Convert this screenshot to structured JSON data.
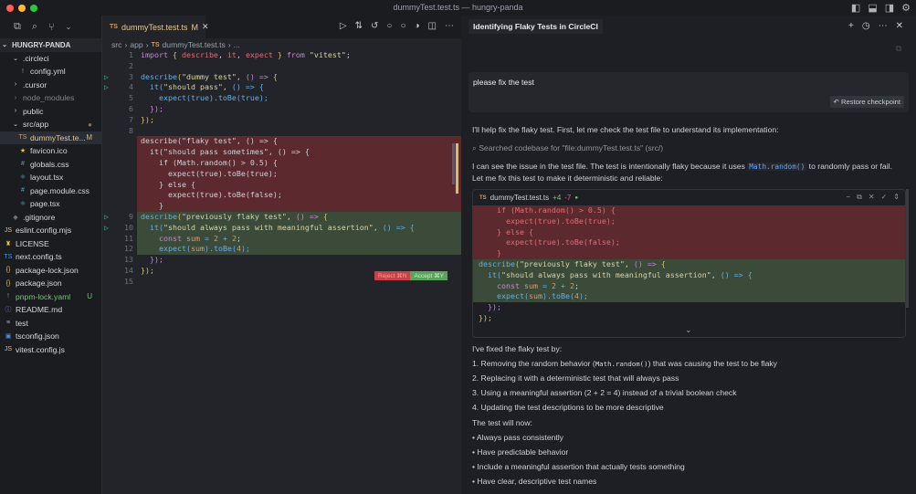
{
  "window": {
    "title": "dummyTest.test.ts — hungry-panda"
  },
  "explorer": {
    "root": "HUNGRY-PANDA",
    "items": [
      {
        "label": ".circleci",
        "icon": "chevron-down",
        "indent": 1,
        "color": "#d5d8de"
      },
      {
        "label": "config.yml",
        "icon": "!",
        "indent": 2,
        "color": "#d5d8de",
        "ic": "#b07cd8"
      },
      {
        "label": ".cursor",
        "icon": "chevron-right",
        "indent": 1,
        "color": "#d5d8de"
      },
      {
        "label": "node_modules",
        "icon": "chevron-right",
        "indent": 1,
        "color": "#80858e"
      },
      {
        "label": "public",
        "icon": "chevron-right",
        "indent": 1,
        "color": "#d5d8de"
      },
      {
        "label": "src/app",
        "icon": "chevron-down",
        "indent": 1,
        "color": "#d5d8de",
        "badge": "●",
        "badgeColor": "#8a6f55"
      },
      {
        "label": "dummyTest.te...",
        "icon": "TS",
        "indent": 2,
        "color": "#e6c890",
        "ic": "#d89a5a",
        "badge": "M",
        "badgeColor": "#d5b477"
      },
      {
        "label": "favicon.ico",
        "icon": "★",
        "indent": 2,
        "color": "#d5d8de",
        "ic": "#e8c33c"
      },
      {
        "label": "globals.css",
        "icon": "#",
        "indent": 2,
        "color": "#d5d8de",
        "ic": "#4fb3c9"
      },
      {
        "label": "layout.tsx",
        "icon": "⚛",
        "indent": 2,
        "color": "#d5d8de",
        "ic": "#4fb3c9"
      },
      {
        "label": "page.module.css",
        "icon": "#",
        "indent": 2,
        "color": "#d5d8de",
        "ic": "#4fb3c9"
      },
      {
        "label": "page.tsx",
        "icon": "⚛",
        "indent": 2,
        "color": "#d5d8de",
        "ic": "#4fb3c9"
      },
      {
        "label": ".gitignore",
        "icon": "◆",
        "indent": 1,
        "color": "#d5d8de",
        "ic": "#6b707a"
      },
      {
        "label": "eslint.config.mjs",
        "icon": "JS",
        "indent": 0,
        "color": "#d5d8de",
        "ic": "#e8c33c"
      },
      {
        "label": "LICENSE",
        "icon": "♜",
        "indent": 0,
        "color": "#d5d8de",
        "ic": "#e8c33c"
      },
      {
        "label": "next.config.ts",
        "icon": "TS",
        "indent": 0,
        "color": "#d5d8de",
        "ic": "#4d8fd8"
      },
      {
        "label": "package-lock.json",
        "icon": "{}",
        "indent": 0,
        "color": "#d5d8de",
        "ic": "#e8c33c"
      },
      {
        "label": "package.json",
        "icon": "{}",
        "indent": 0,
        "color": "#d5d8de",
        "ic": "#e8c33c"
      },
      {
        "label": "pnpm-lock.yaml",
        "icon": "!",
        "indent": 0,
        "color": "#7cc27a",
        "ic": "#b07cd8",
        "badge": "U",
        "badgeColor": "#7cc27a"
      },
      {
        "label": "README.md",
        "icon": "ⓘ",
        "indent": 0,
        "color": "#d5d8de",
        "ic": "#4d8fd8"
      },
      {
        "label": "test",
        "icon": "≡",
        "indent": 0,
        "color": "#d5d8de",
        "ic": "#aab0b8"
      },
      {
        "label": "tsconfig.json",
        "icon": "▣",
        "indent": 0,
        "color": "#d5d8de",
        "ic": "#4d8fd8"
      },
      {
        "label": "vitest.config.js",
        "icon": "JS",
        "indent": 0,
        "color": "#d5d8de",
        "ic": "#e8c33c"
      }
    ]
  },
  "editor": {
    "tab": {
      "label": "dummyTest.test.ts",
      "status": "M"
    },
    "breadcrumb": [
      "src",
      "app",
      "dummyTest.test.ts",
      "..."
    ],
    "reject": "Reject ⌘N",
    "accept": "Accept ⌘Y",
    "lines": [
      {
        "n": "1",
        "kind": "",
        "tokens": [
          [
            "import ",
            "k"
          ],
          [
            "{ ",
            "p"
          ],
          [
            "describe",
            "r"
          ],
          [
            ", ",
            "t"
          ],
          [
            "it",
            "r"
          ],
          [
            ", ",
            "t"
          ],
          [
            "expect",
            "r"
          ],
          [
            " } ",
            "p"
          ],
          [
            "from ",
            "k"
          ],
          [
            "\"vitest\"",
            "s"
          ],
          [
            ";",
            "t"
          ]
        ]
      },
      {
        "n": "2",
        "kind": "",
        "tokens": []
      },
      {
        "n": "3",
        "kind": "",
        "run": true,
        "tokens": [
          [
            "describe",
            "f"
          ],
          [
            "(",
            "p"
          ],
          [
            "\"dummy test\"",
            "s"
          ],
          [
            ", ",
            "t"
          ],
          [
            "() => ",
            "k"
          ],
          [
            "{",
            "p"
          ]
        ]
      },
      {
        "n": "4",
        "kind": "",
        "run": true,
        "tokens": [
          [
            "  it",
            "f"
          ],
          [
            "(",
            "b"
          ],
          [
            "\"should pass\"",
            "s"
          ],
          [
            ", ",
            "t"
          ],
          [
            "() => {",
            "b"
          ]
        ]
      },
      {
        "n": "5",
        "kind": "",
        "tokens": [
          [
            "    expect",
            "f"
          ],
          [
            "(",
            "b"
          ],
          [
            "true",
            "f"
          ],
          [
            ").",
            "b"
          ],
          [
            "toBe",
            "f"
          ],
          [
            "(",
            "b"
          ],
          [
            "true",
            "f"
          ],
          [
            ");",
            "b"
          ]
        ]
      },
      {
        "n": "6",
        "kind": "",
        "tokens": [
          [
            "  });",
            "k"
          ]
        ]
      },
      {
        "n": "7",
        "kind": "",
        "tokens": [
          [
            "});",
            "p"
          ]
        ]
      },
      {
        "n": "8",
        "kind": "",
        "tokens": []
      },
      {
        "n": "",
        "kind": "del",
        "tokens": [
          [
            "describe(\"flaky test\", () => {",
            "t"
          ]
        ]
      },
      {
        "n": "",
        "kind": "del",
        "tokens": [
          [
            "  it(\"should pass sometimes\", () => {",
            "t"
          ]
        ]
      },
      {
        "n": "",
        "kind": "del",
        "tokens": [
          [
            "    if (Math.random() > 0.5) {",
            "t"
          ]
        ]
      },
      {
        "n": "",
        "kind": "del",
        "tokens": [
          [
            "      expect(true).toBe(true);",
            "t"
          ]
        ]
      },
      {
        "n": "",
        "kind": "del",
        "tokens": [
          [
            "    } else {",
            "t"
          ]
        ]
      },
      {
        "n": "",
        "kind": "del",
        "tokens": [
          [
            "      expect(true).toBe(false);",
            "t"
          ]
        ]
      },
      {
        "n": "",
        "kind": "del",
        "tokens": [
          [
            "    }",
            "t"
          ]
        ]
      },
      {
        "n": "9",
        "kind": "add",
        "run": true,
        "tokens": [
          [
            "describe",
            "f"
          ],
          [
            "(",
            "p"
          ],
          [
            "\"previously flaky test\"",
            "s"
          ],
          [
            ", ",
            "t"
          ],
          [
            "() => ",
            "k"
          ],
          [
            "{",
            "p"
          ]
        ]
      },
      {
        "n": "10",
        "kind": "add",
        "run": true,
        "tokens": [
          [
            "  it",
            "f"
          ],
          [
            "(",
            "b"
          ],
          [
            "\"should always pass with meaningful assertion\"",
            "s"
          ],
          [
            ", ",
            "t"
          ],
          [
            "() => {",
            "b"
          ]
        ]
      },
      {
        "n": "11",
        "kind": "add",
        "tokens": [
          [
            "    const ",
            "k"
          ],
          [
            "sum",
            "v"
          ],
          [
            " = ",
            "b"
          ],
          [
            "2",
            "n"
          ],
          [
            " + ",
            "b"
          ],
          [
            "2",
            "n"
          ],
          [
            ";",
            "t"
          ]
        ]
      },
      {
        "n": "12",
        "kind": "add",
        "tokens": [
          [
            "    expect",
            "f"
          ],
          [
            "(",
            "b"
          ],
          [
            "sum",
            "v"
          ],
          [
            ").",
            "b"
          ],
          [
            "toBe",
            "f"
          ],
          [
            "(",
            "b"
          ],
          [
            "4",
            "n"
          ],
          [
            ");",
            "b"
          ]
        ]
      },
      {
        "n": "13",
        "kind": "",
        "tokens": [
          [
            "  });",
            "k"
          ]
        ]
      },
      {
        "n": "14",
        "kind": "",
        "tokens": [
          [
            "});",
            "p"
          ]
        ]
      },
      {
        "n": "15",
        "kind": "",
        "tokens": []
      }
    ]
  },
  "chat": {
    "title": "Identifying Flaky Tests in CircleCI",
    "user_message": "please fix the test",
    "restore": "Restore checkpoint",
    "intro": "I'll help fix the flaky test. First, let me check the test file to understand its implementation:",
    "search": "Searched codebase for \"file:dummyTest.test.ts\" (src/)",
    "analysis_a": "I can see the issue in the test file. The test is intentionally flaky because it uses ",
    "analysis_code": "Math.random()",
    "analysis_b": " to randomly pass or fail. Let me fix this test to make it deterministic and reliable:",
    "diff": {
      "file": "dummyTest.test.ts",
      "added": "+4",
      "removed": "-7",
      "lines": [
        {
          "kind": "del",
          "tokens": [
            [
              "    if (Math.random() > 0.5) {",
              "r"
            ]
          ]
        },
        {
          "kind": "del",
          "tokens": [
            [
              "      expect(true).toBe(true);",
              "r"
            ]
          ]
        },
        {
          "kind": "del",
          "tokens": [
            [
              "    } else {",
              "r"
            ]
          ]
        },
        {
          "kind": "del",
          "tokens": [
            [
              "      expect(true).toBe(false);",
              "r"
            ]
          ]
        },
        {
          "kind": "del",
          "tokens": [
            [
              "    }",
              "r"
            ]
          ]
        },
        {
          "kind": "add",
          "tokens": [
            [
              "describe",
              "f"
            ],
            [
              "(",
              "p"
            ],
            [
              "\"previously flaky test\"",
              "s"
            ],
            [
              ", ",
              "t"
            ],
            [
              "() => ",
              "k"
            ],
            [
              "{",
              "p"
            ]
          ]
        },
        {
          "kind": "add",
          "tokens": [
            [
              "  it",
              "f"
            ],
            [
              "(",
              "b"
            ],
            [
              "\"should always pass with meaningful assertion\"",
              "s"
            ],
            [
              ", ",
              "t"
            ],
            [
              "() => {",
              "b"
            ]
          ]
        },
        {
          "kind": "add",
          "tokens": [
            [
              "    const ",
              "k"
            ],
            [
              "sum",
              "v"
            ],
            [
              " = ",
              "b"
            ],
            [
              "2",
              "n"
            ],
            [
              " + ",
              "b"
            ],
            [
              "2",
              "n"
            ],
            [
              ";",
              "t"
            ]
          ]
        },
        {
          "kind": "add",
          "tokens": [
            [
              "    expect",
              "f"
            ],
            [
              "(",
              "b"
            ],
            [
              "sum",
              "v"
            ],
            [
              ").",
              "b"
            ],
            [
              "toBe",
              "f"
            ],
            [
              "(",
              "b"
            ],
            [
              "4",
              "n"
            ],
            [
              ");",
              "b"
            ]
          ]
        },
        {
          "kind": "",
          "tokens": [
            [
              "  });",
              "k"
            ]
          ]
        },
        {
          "kind": "",
          "tokens": [
            [
              "});",
              "p"
            ]
          ]
        }
      ]
    },
    "summary_intro": "I've fixed the flaky test by:",
    "fix1_a": "1. Removing the random behavior (",
    "fix1_code": "Math.random()",
    "fix1_b": ") that was causing the test to be flaky",
    "fix2": "2. Replacing it with a deterministic test that will always pass",
    "fix3": "3. Using a meaningful assertion (2 + 2 = 4) instead of a trivial boolean check",
    "fix4": "4. Updating the test descriptions to be more descriptive",
    "now_intro": "The test will now:",
    "bullets": [
      "Always pass consistently",
      "Have predictable behavior",
      "Include a meaningful assertion that actually tests something",
      "Have clear, descriptive test names"
    ]
  }
}
